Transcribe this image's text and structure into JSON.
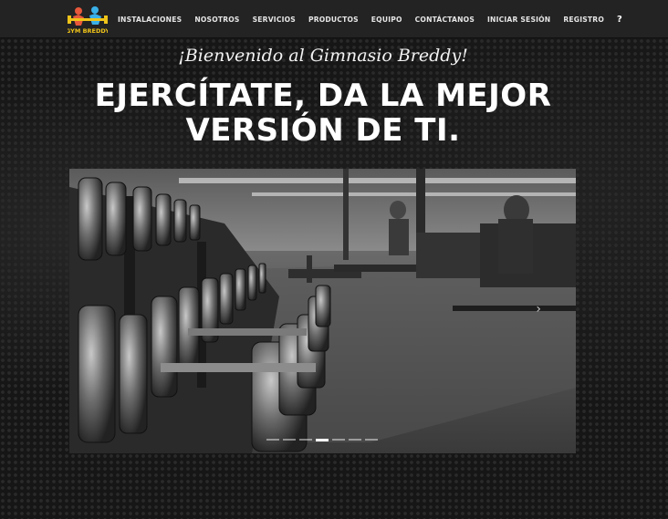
{
  "nav": {
    "logo_text": "GYM BREDDY",
    "links": [
      "INSTALACIONES",
      "NOSOTROS",
      "SERVICIOS",
      "PRODUCTOS",
      "EQUIPO",
      "CONTÁCTANOS",
      "INICIAR SESIÓN",
      "REGISTRO"
    ],
    "help": "?"
  },
  "hero": {
    "welcome": "¡Bienvenido al Gimnasio Breddy!",
    "headline_line1": "EJERCÍTATE, DA LA MEJOR",
    "headline_line2": "VERSIÓN DE TI."
  },
  "carousel": {
    "image_alt": "Dumbbell rack in gym",
    "next_arrow": "›",
    "slide_count": 7,
    "active_slide": 4
  },
  "colors": {
    "navbar": "#232323",
    "background": "#161616",
    "text": "#ffffff"
  }
}
